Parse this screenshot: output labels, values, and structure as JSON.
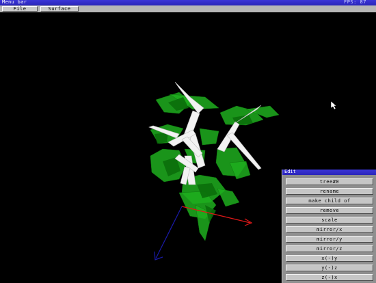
{
  "window": {
    "title": "Menu bar",
    "fps": "FPS: 87"
  },
  "menubar": {
    "items": [
      {
        "label": "File"
      },
      {
        "label": "Surface"
      }
    ]
  },
  "edit_panel": {
    "title": "Edit",
    "buttons": [
      {
        "label": "tree#0"
      },
      {
        "label": "rename"
      },
      {
        "label": "make child of"
      },
      {
        "label": "remove"
      },
      {
        "label": "scale"
      },
      {
        "label": "mirror/x"
      },
      {
        "label": "mirror/y"
      },
      {
        "label": "mirror/z"
      },
      {
        "label": "x(-)y"
      },
      {
        "label": "y(-)z"
      },
      {
        "label": "z(-)x"
      }
    ]
  },
  "scene": {
    "object": "3d-tree-model",
    "colors": {
      "leaf": "#1fae1f",
      "leaf_dark": "#0b6e0b",
      "branch": "#ffffff",
      "axis_x": "#e01818",
      "axis_y": "#1a1aa8",
      "background": "#000000"
    }
  }
}
